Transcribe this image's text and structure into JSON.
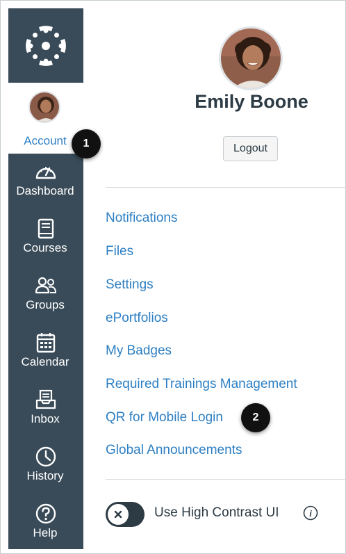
{
  "nav": {
    "account_label": "Account",
    "items": [
      {
        "label": "Dashboard",
        "icon": "dashboard-icon"
      },
      {
        "label": "Courses",
        "icon": "courses-icon"
      },
      {
        "label": "Groups",
        "icon": "groups-icon"
      },
      {
        "label": "Calendar",
        "icon": "calendar-icon"
      },
      {
        "label": "Inbox",
        "icon": "inbox-icon"
      },
      {
        "label": "History",
        "icon": "history-icon"
      },
      {
        "label": "Help",
        "icon": "help-icon"
      }
    ]
  },
  "profile": {
    "name": "Emily Boone",
    "logout_label": "Logout"
  },
  "links": [
    "Notifications",
    "Files",
    "Settings",
    "ePortfolios",
    "My Badges",
    "Required Trainings Management",
    "QR for Mobile Login",
    "Global Announcements"
  ],
  "contrast": {
    "label": "Use High Contrast UI",
    "enabled": false
  },
  "callouts": [
    "1",
    "2"
  ],
  "colors": {
    "nav_bg": "#394b58",
    "link": "#2d7fc3",
    "text": "#2d3b45"
  }
}
